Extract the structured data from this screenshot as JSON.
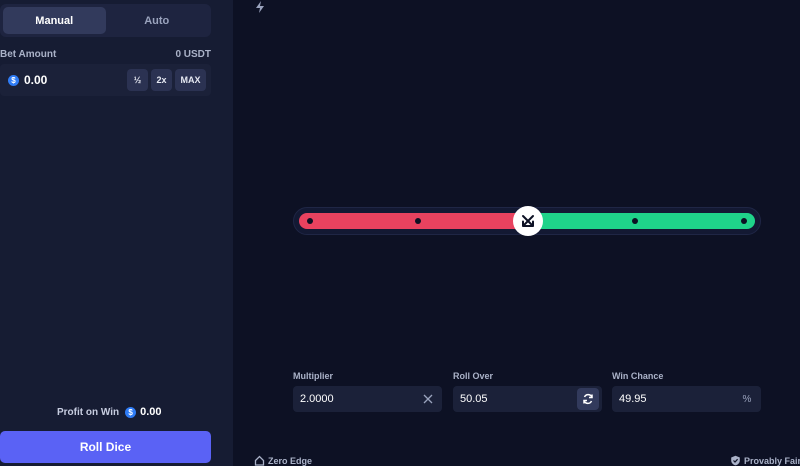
{
  "mode_tabs": {
    "manual": "Manual",
    "auto": "Auto"
  },
  "bet": {
    "label": "Bet Amount",
    "balance": "0 USDT",
    "currency_symbol": "$",
    "value": "0.00",
    "half_label": "½",
    "double_label": "2x",
    "max_label": "MAX"
  },
  "profit": {
    "label": "Profit on Win",
    "currency_symbol": "$",
    "value": "0.00"
  },
  "roll_button": "Roll Dice",
  "slider": {
    "value": 50.05,
    "min": 0,
    "max": 100,
    "lose_color": "#e8425f",
    "win_color": "#1fd38a"
  },
  "fields": {
    "multiplier": {
      "label": "Multiplier",
      "value": "2.0000",
      "icon": "close-icon"
    },
    "roll_over": {
      "label": "Roll Over",
      "value": "50.05",
      "icon": "refresh-icon"
    },
    "win_chance": {
      "label": "Win Chance",
      "value": "49.95",
      "icon": "percent-icon",
      "suffix": "%"
    }
  },
  "footer": {
    "left": "Zero Edge",
    "right": "Provably Fair"
  },
  "colors": {
    "accent": "#5a62f5",
    "coin": "#2f7cf6"
  }
}
